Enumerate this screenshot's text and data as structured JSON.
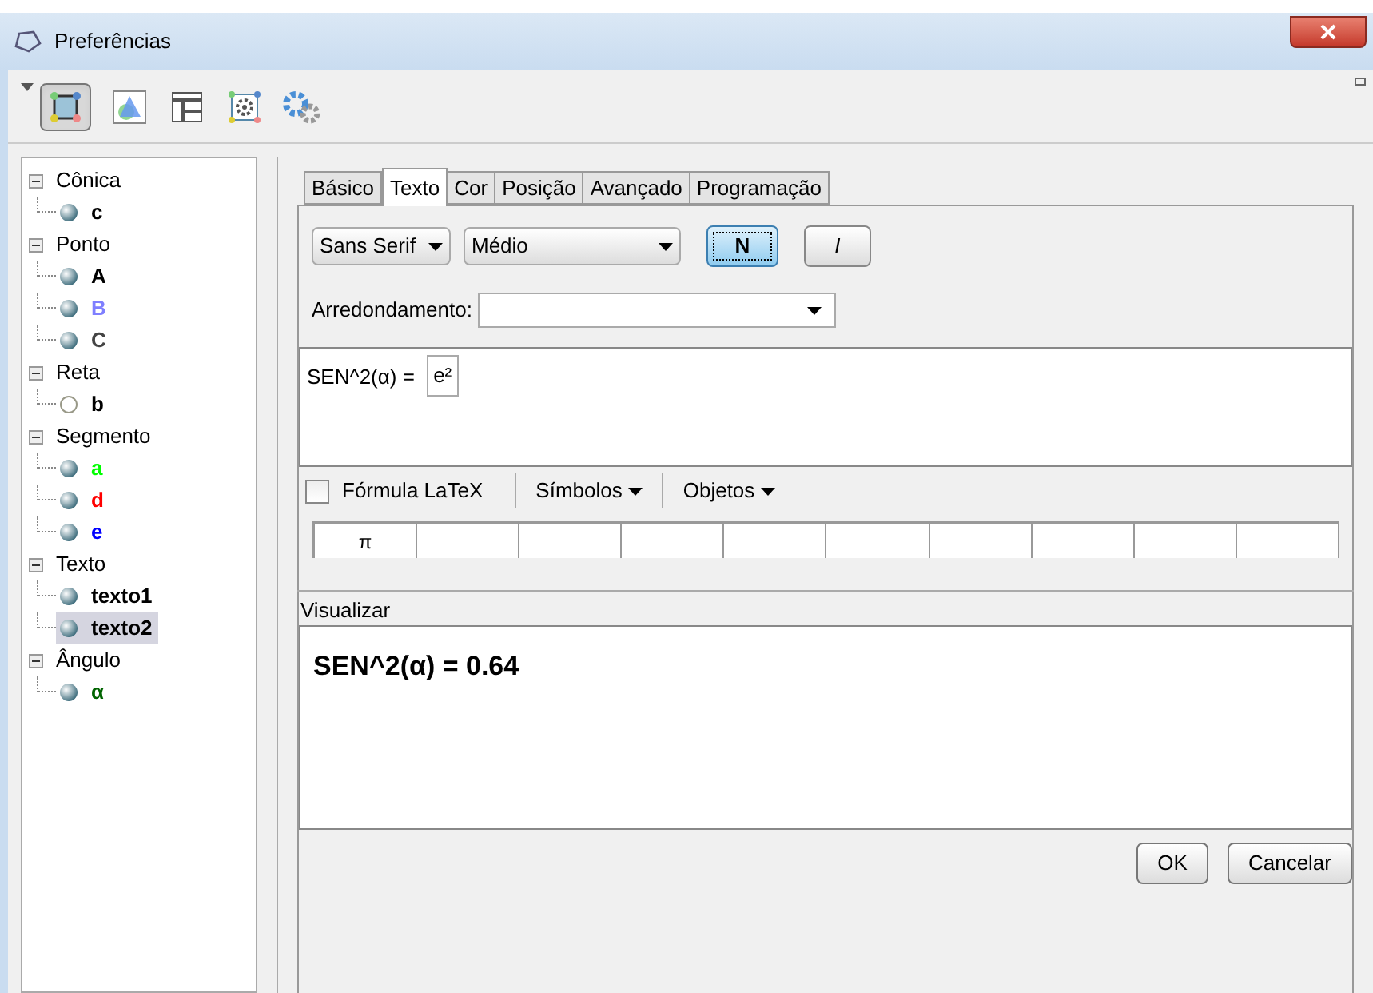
{
  "window": {
    "title": "Preferências"
  },
  "toolbar": {
    "items": [
      {
        "kind": "object",
        "selected": true
      },
      {
        "kind": "graphics",
        "selected": false
      },
      {
        "kind": "layout",
        "selected": false
      },
      {
        "kind": "defaults",
        "selected": false
      },
      {
        "kind": "advanced",
        "selected": false
      }
    ]
  },
  "tree": [
    {
      "label": "Cônica",
      "expanded": true,
      "children": [
        {
          "label": "c",
          "color": "#000000",
          "selected": false,
          "visible": true
        }
      ]
    },
    {
      "label": "Ponto",
      "expanded": true,
      "children": [
        {
          "label": "A",
          "color": "#000000",
          "selected": false,
          "visible": true
        },
        {
          "label": "B",
          "color": "#7f7fff",
          "selected": false,
          "visible": true
        },
        {
          "label": "C",
          "color": "#444444",
          "selected": false,
          "visible": true
        }
      ]
    },
    {
      "label": "Reta",
      "expanded": true,
      "children": [
        {
          "label": "b",
          "color": "#000000",
          "selected": false,
          "visible": false
        }
      ]
    },
    {
      "label": "Segmento",
      "expanded": true,
      "children": [
        {
          "label": "a",
          "color": "#00ff00",
          "selected": false,
          "visible": true
        },
        {
          "label": "d",
          "color": "#ff0000",
          "selected": false,
          "visible": true
        },
        {
          "label": "e",
          "color": "#0000ff",
          "selected": false,
          "visible": true
        }
      ]
    },
    {
      "label": "Texto",
      "expanded": true,
      "children": [
        {
          "label": "texto1",
          "color": "#000000",
          "selected": false,
          "visible": true
        },
        {
          "label": "texto2",
          "color": "#000000",
          "selected": true,
          "visible": true
        }
      ]
    },
    {
      "label": "Ângulo",
      "expanded": true,
      "children": [
        {
          "label": "α",
          "color": "#006400",
          "selected": false,
          "visible": true
        }
      ]
    }
  ],
  "tabs": [
    {
      "label": "Básico",
      "selected": false
    },
    {
      "label": "Texto",
      "selected": true
    },
    {
      "label": "Cor",
      "selected": false
    },
    {
      "label": "Posição",
      "selected": false
    },
    {
      "label": "Avançado",
      "selected": false
    },
    {
      "label": "Programação",
      "selected": false
    }
  ],
  "font_family": "Sans Serif",
  "font_size": "Médio",
  "bold_button": {
    "label": "N",
    "selected": true
  },
  "italic_button": {
    "label": "I",
    "selected": false
  },
  "rounding": {
    "label": "Arredondamento:"
  },
  "editor": {
    "text": "SEN^2(α) = ",
    "object_field": "e²"
  },
  "latex": {
    "label": "Fórmula LaTeX",
    "checked": false
  },
  "menus": [
    "Símbolos",
    "Objetos"
  ],
  "symbols": [
    "π"
  ],
  "preview": {
    "label": "Visualizar",
    "text": "SEN^2(α) = 0.64"
  },
  "buttons": [
    "OK",
    "Cancelar"
  ]
}
